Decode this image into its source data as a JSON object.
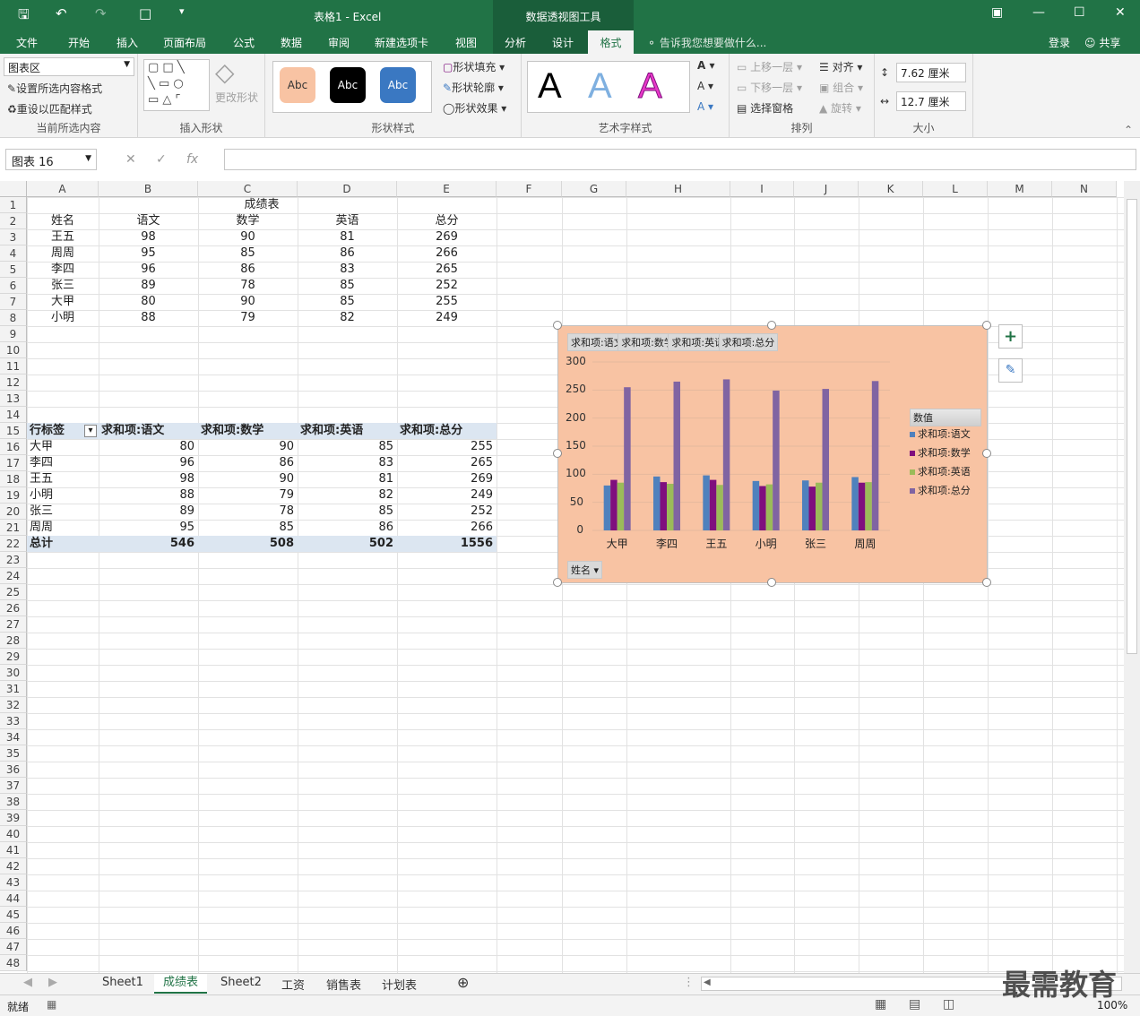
{
  "title_bar": {
    "title": "表格1 - Excel",
    "context_title": "数据透视图工具",
    "save_icon": "save-icon",
    "undo_icon": "undo-icon",
    "redo_icon": "redo-icon"
  },
  "tabs": [
    "文件",
    "开始",
    "插入",
    "页面布局",
    "公式",
    "数据",
    "审阅",
    "新建选项卡",
    "视图",
    "分析",
    "设计",
    "格式"
  ],
  "active_tab": "格式",
  "tell_me": "告诉我您想要做什么...",
  "login": "登录",
  "share": "共享",
  "ribbon": {
    "current_selection": {
      "select": "图表区",
      "set_format": "设置所选内容格式",
      "reset_style": "重设以匹配样式",
      "label": "当前所选内容"
    },
    "insert_shapes": {
      "change_shape": "更改形状",
      "label": "插入形状"
    },
    "shape_styles": {
      "presets": [
        {
          "text": "Abc",
          "bg": "#f8c3a3",
          "fg": "#333"
        },
        {
          "text": "Abc",
          "bg": "#000000",
          "fg": "#fff"
        },
        {
          "text": "Abc",
          "bg": "#3a78c2",
          "fg": "#fff"
        }
      ],
      "fill": "形状填充",
      "outline": "形状轮廓",
      "effects": "形状效果",
      "label": "形状样式"
    },
    "wordart": {
      "letter": "A",
      "label": "艺术字样式"
    },
    "arrange": {
      "bring_forward": "上移一层",
      "send_backward": "下移一层",
      "selection_pane": "选择窗格",
      "align": "对齐",
      "group": "组合",
      "rotate": "旋转",
      "label": "排列"
    },
    "size": {
      "height": "7.62 厘米",
      "width": "12.7 厘米",
      "label": "大小"
    }
  },
  "formula_bar": {
    "name_box": "图表 16",
    "fx": "fx",
    "value": ""
  },
  "columns": [
    "A",
    "B",
    "C",
    "D",
    "E",
    "F",
    "G",
    "H",
    "I",
    "J",
    "K",
    "L",
    "M",
    "N"
  ],
  "table": {
    "title": "成绩表",
    "headers": [
      "姓名",
      "语文",
      "数学",
      "英语",
      "总分"
    ],
    "rows": [
      [
        "王五",
        "98",
        "90",
        "81",
        "269"
      ],
      [
        "周周",
        "95",
        "85",
        "86",
        "266"
      ],
      [
        "李四",
        "96",
        "86",
        "83",
        "265"
      ],
      [
        "张三",
        "89",
        "78",
        "85",
        "252"
      ],
      [
        "大甲",
        "80",
        "90",
        "85",
        "255"
      ],
      [
        "小明",
        "88",
        "79",
        "82",
        "249"
      ]
    ]
  },
  "pivot": {
    "headers": [
      "行标签",
      "求和项:语文",
      "求和项:数学",
      "求和项:英语",
      "求和项:总分"
    ],
    "rows": [
      [
        "大甲",
        "80",
        "90",
        "85",
        "255"
      ],
      [
        "李四",
        "96",
        "86",
        "83",
        "265"
      ],
      [
        "王五",
        "98",
        "90",
        "81",
        "269"
      ],
      [
        "小明",
        "88",
        "79",
        "82",
        "249"
      ],
      [
        "张三",
        "89",
        "78",
        "85",
        "252"
      ],
      [
        "周周",
        "95",
        "85",
        "86",
        "266"
      ]
    ],
    "total": [
      "总计",
      "546",
      "508",
      "502",
      "1556"
    ]
  },
  "chart_data": {
    "type": "bar",
    "field_buttons": [
      "求和项:语文",
      "求和项:数学",
      "求和项:英语",
      "求和项:总分"
    ],
    "axis_field": "姓名",
    "legend_title": "数值",
    "categories": [
      "大甲",
      "李四",
      "王五",
      "小明",
      "张三",
      "周周"
    ],
    "series": [
      {
        "name": "求和项:语文",
        "color": "#4f81bd",
        "values": [
          80,
          96,
          98,
          88,
          89,
          95
        ]
      },
      {
        "name": "求和项:数学",
        "color": "#7f0f7e",
        "values": [
          90,
          86,
          90,
          79,
          78,
          85
        ]
      },
      {
        "name": "求和项:英语",
        "color": "#9bbb59",
        "values": [
          85,
          83,
          81,
          82,
          85,
          86
        ]
      },
      {
        "name": "求和项:总分",
        "color": "#8064a2",
        "values": [
          255,
          265,
          269,
          249,
          252,
          266
        ]
      }
    ],
    "ylim": [
      0,
      300
    ],
    "yticks": [
      "300",
      "250",
      "200",
      "150",
      "100",
      "50",
      "0"
    ],
    "legend": "right"
  },
  "sheets": [
    "Sheet1",
    "成绩表",
    "Sheet2",
    "工资",
    "销售表",
    "计划表"
  ],
  "active_sheet": "成绩表",
  "status": {
    "ready": "就绪",
    "zoom": "100%"
  },
  "watermark": "最需教育"
}
